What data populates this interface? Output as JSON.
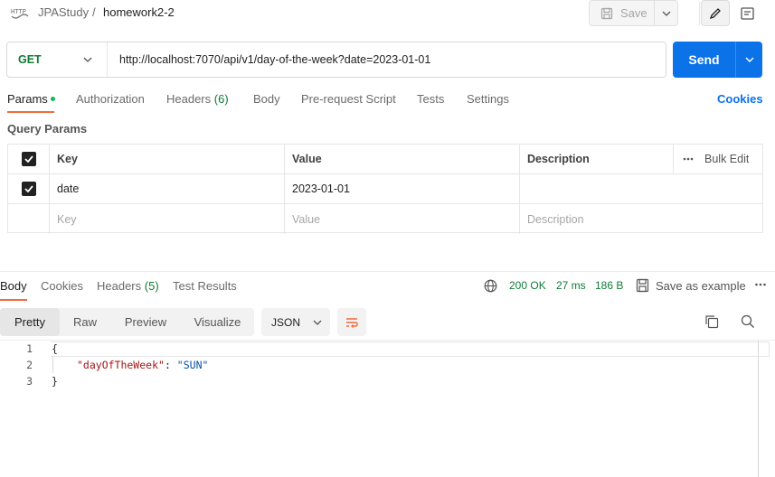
{
  "breadcrumb": {
    "collection": "JPAStudy",
    "separator": "/",
    "request": "homework2-2"
  },
  "toolbar": {
    "save_label": "Save"
  },
  "request": {
    "method": "GET",
    "url": "http://localhost:7070/api/v1/day-of-the-week?date=2023-01-01",
    "send_label": "Send"
  },
  "request_tabs": [
    {
      "label": "Params",
      "active": true,
      "dot": true
    },
    {
      "label": "Authorization"
    },
    {
      "label": "Headers",
      "count": "(6)"
    },
    {
      "label": "Body"
    },
    {
      "label": "Pre-request Script"
    },
    {
      "label": "Tests"
    },
    {
      "label": "Settings"
    }
  ],
  "cookies_label": "Cookies",
  "query_params": {
    "title": "Query Params",
    "headers": {
      "key": "Key",
      "value": "Value",
      "description": "Description",
      "bulk_edit": "Bulk Edit"
    },
    "rows": [
      {
        "checked": true,
        "key": "date",
        "value": "2023-01-01",
        "description": ""
      }
    ],
    "placeholders": {
      "key": "Key",
      "value": "Value",
      "description": "Description"
    }
  },
  "response_tabs": [
    {
      "label": "Body",
      "active": true
    },
    {
      "label": "Cookies"
    },
    {
      "label": "Headers",
      "count": "(5)"
    },
    {
      "label": "Test Results"
    }
  ],
  "response_meta": {
    "status": "200 OK",
    "time": "27 ms",
    "size": "186 B",
    "save_example": "Save as example"
  },
  "view_modes": [
    "Pretty",
    "Raw",
    "Preview",
    "Visualize"
  ],
  "active_view_mode": "Pretty",
  "format": "JSON",
  "response_body": {
    "line_numbers": [
      "1",
      "2",
      "3"
    ],
    "open_brace": "{",
    "key": "\"dayOfTheWeek\"",
    "colon": ": ",
    "value": "\"SUN\"",
    "close_brace": "}"
  },
  "icons": [
    "http-icon",
    "save-icon",
    "chevron-down-icon",
    "pencil-icon",
    "document-icon",
    "checkbox-checked-icon",
    "more-horizontal-icon",
    "globe-icon",
    "save-example-icon",
    "wrap-lines-icon",
    "copy-icon",
    "search-icon"
  ],
  "colors": {
    "accent": "#f26b3a",
    "send": "#0b72e8",
    "method": "#0f7a36",
    "status_ok": "#0f7a36",
    "params_dot": "#0cbb52"
  }
}
